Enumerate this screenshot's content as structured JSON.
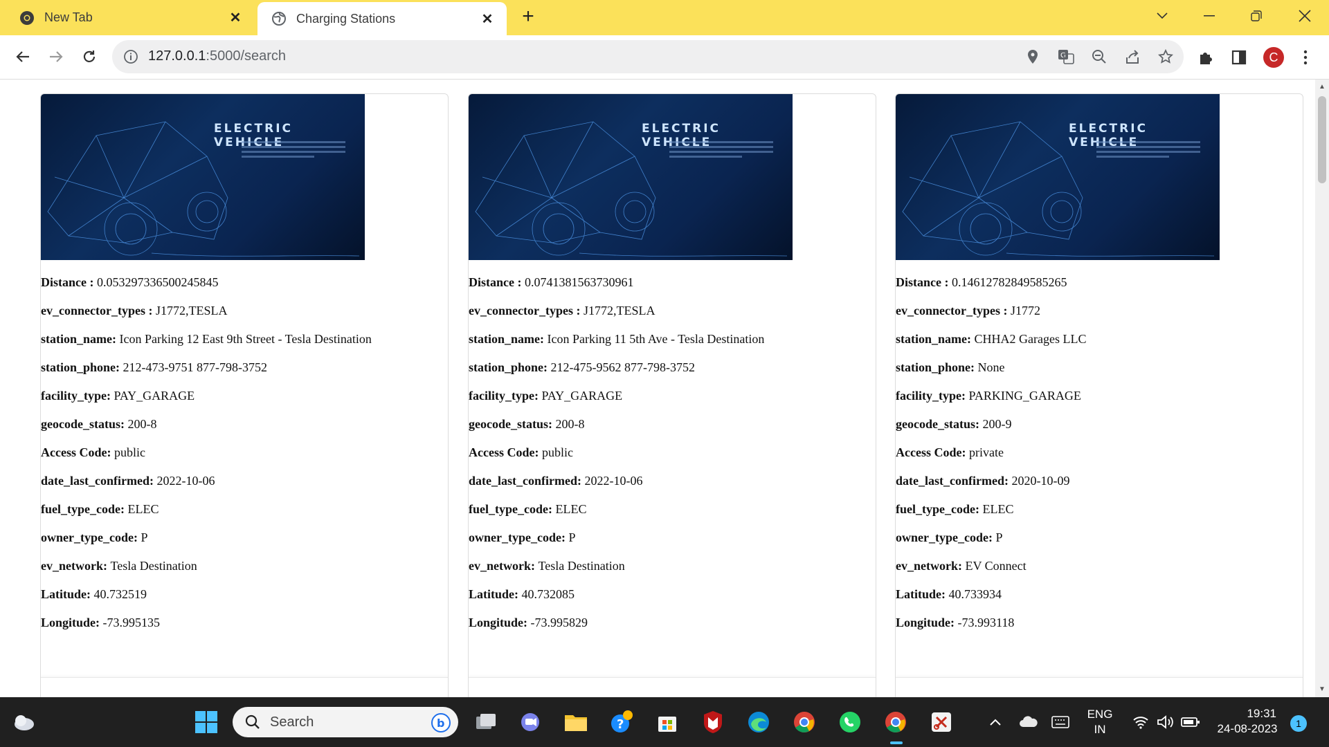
{
  "browser": {
    "tabs": [
      {
        "title": "New Tab",
        "active": false
      },
      {
        "title": "Charging Stations",
        "active": true
      }
    ],
    "address": {
      "host": "127.0.0.1",
      "path": ":5000/search"
    },
    "profile_initial": "C"
  },
  "image_caption": "ELECTRIC VEHICLE",
  "stations": [
    {
      "distance": "0.053297336500245845",
      "ev_connector_types": "J1772,TESLA",
      "station_name": "Icon Parking 12 East 9th Street - Tesla Destination",
      "station_phone": "212-473-9751 877-798-3752",
      "facility_type": "PAY_GARAGE",
      "geocode_status": "200-8",
      "access_code": "public",
      "date_last_confirmed": "2022-10-06",
      "fuel_type_code": "ELEC",
      "owner_type_code": "P",
      "ev_network": "Tesla Destination",
      "latitude": "40.732519",
      "longitude": "-73.995135"
    },
    {
      "distance": "0.0741381563730961",
      "ev_connector_types": "J1772,TESLA",
      "station_name": "Icon Parking 11 5th Ave - Tesla Destination",
      "station_phone": "212-475-9562 877-798-3752",
      "facility_type": "PAY_GARAGE",
      "geocode_status": "200-8",
      "access_code": "public",
      "date_last_confirmed": "2022-10-06",
      "fuel_type_code": "ELEC",
      "owner_type_code": "P",
      "ev_network": "Tesla Destination",
      "latitude": "40.732085",
      "longitude": "-73.995829"
    },
    {
      "distance": "0.14612782849585265",
      "ev_connector_types": "J1772",
      "station_name": "CHHA2 Garages LLC",
      "station_phone": "None",
      "facility_type": "PARKING_GARAGE",
      "geocode_status": "200-9",
      "access_code": "private",
      "date_last_confirmed": "2020-10-09",
      "fuel_type_code": "ELEC",
      "owner_type_code": "P",
      "ev_network": "EV Connect",
      "latitude": "40.733934",
      "longitude": "-73.993118"
    }
  ],
  "labels": {
    "distance": "Distance : ",
    "ev_connector_types": "ev_connector_types : ",
    "station_name": "station_name: ",
    "station_phone": "station_phone: ",
    "facility_type": "facility_type: ",
    "geocode_status": "geocode_status: ",
    "access_code": "Access Code: ",
    "date_last_confirmed": "date_last_confirmed: ",
    "fuel_type_code": "fuel_type_code: ",
    "owner_type_code": "owner_type_code: ",
    "ev_network": "ev_network: ",
    "latitude": "Latitude: ",
    "longitude": "Longitude: "
  },
  "taskbar": {
    "search_placeholder": "Search",
    "language": "ENG",
    "region": "IN",
    "time": "19:31",
    "date": "24-08-2023",
    "notification_count": "1"
  }
}
